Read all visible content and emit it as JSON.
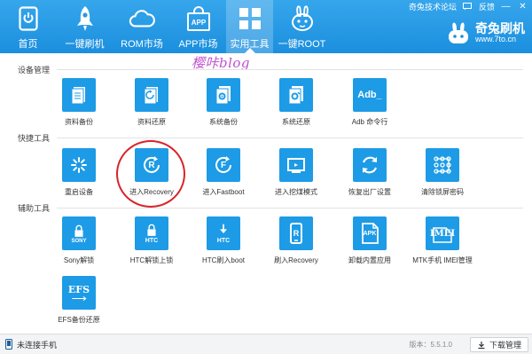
{
  "nav": {
    "items": [
      {
        "label": "首页",
        "icon": "phone-home-icon"
      },
      {
        "label": "一键刷机",
        "icon": "rocket-icon"
      },
      {
        "label": "ROM市场",
        "icon": "cloud-icon"
      },
      {
        "label": "APP市场",
        "icon": "shopping-bag-icon"
      },
      {
        "label": "实用工具",
        "icon": "grid-icon",
        "active": true
      },
      {
        "label": "一键ROOT",
        "icon": "rabbit-icon"
      }
    ]
  },
  "topbar": {
    "forum": "奇兔技术论坛",
    "feedback": "反馈",
    "min_glyph": "—",
    "close_glyph": "✕"
  },
  "logo": {
    "name": "奇兔刷机",
    "url": "www.7to.cn"
  },
  "watermark": "樱咔blog",
  "sections": {
    "device": {
      "title": "设备管理",
      "tools": [
        {
          "label": "资料备份",
          "icon": "document-backup-icon"
        },
        {
          "label": "资料还原",
          "icon": "document-restore-icon"
        },
        {
          "label": "系统备份",
          "icon": "system-backup-icon"
        },
        {
          "label": "系统还原",
          "icon": "system-restore-icon"
        },
        {
          "label": "Adb 命令行",
          "icon": "adb-terminal-icon",
          "tile_text": "Adb_"
        }
      ]
    },
    "quick": {
      "title": "快捷工具",
      "tools": [
        {
          "label": "重启设备",
          "icon": "spinner-icon"
        },
        {
          "label": "进入Recovery",
          "icon": "recovery-icon",
          "tile_text": "R"
        },
        {
          "label": "进入Fastboot",
          "icon": "fastboot-icon",
          "tile_text": "F"
        },
        {
          "label": "进入挖煤模式",
          "icon": "download-mode-icon"
        },
        {
          "label": "恢复出厂设置",
          "icon": "factory-reset-icon"
        },
        {
          "label": "清除锁屏密码",
          "icon": "pattern-lock-icon"
        }
      ]
    },
    "aux": {
      "title": "辅助工具",
      "tools": [
        {
          "label": "Sony解锁",
          "icon": "sony-lock-icon",
          "tile_text": "SONY"
        },
        {
          "label": "HTC解锁上锁",
          "icon": "htc-lock-icon",
          "tile_text": "HTC"
        },
        {
          "label": "HTC刷入boot",
          "icon": "htc-boot-icon",
          "tile_text": "HTC"
        },
        {
          "label": "刷入Recovery",
          "icon": "flash-recovery-icon",
          "tile_text": "R"
        },
        {
          "label": "卸载内置应用",
          "icon": "apk-icon",
          "tile_text": "APK"
        },
        {
          "label": "MTK手机 IMEI管理",
          "icon": "imei-icon",
          "tile_text": "IMEI"
        },
        {
          "label": "EFS备份还原",
          "icon": "efs-icon",
          "tile_text": "EFS"
        }
      ]
    }
  },
  "status": {
    "connection": "未连接手机",
    "version": "版本：5.5.1.0",
    "download": "下载管理"
  },
  "colors": {
    "header": "#1b8fde",
    "tile": "#1d9be6",
    "highlight": "#d8242a",
    "watermark": "#c24fd0"
  }
}
